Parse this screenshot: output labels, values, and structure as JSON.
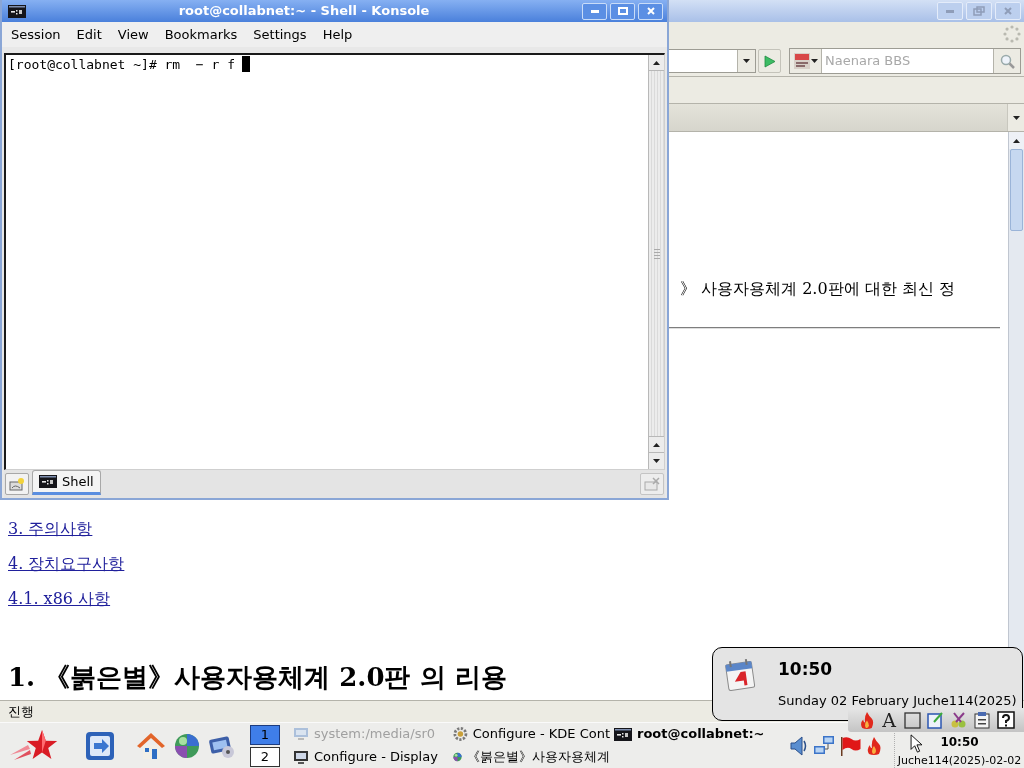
{
  "konsole": {
    "title": "root@collabnet:~ - Shell - Konsole",
    "menu": [
      "Session",
      "Edit",
      "View",
      "Bookmarks",
      "Settings",
      "Help"
    ],
    "terminal": {
      "command_line": "[root@collabnet ~]# rm  − r f"
    },
    "tabs": [
      {
        "label": "Shell",
        "selected": true
      }
    ]
  },
  "browser": {
    "search_field": {
      "placeholder": "Naenara BBS"
    },
    "content": {
      "paragraph": "》 사용자용체계 2.0판에 대한 최신 정",
      "links": [
        "3. 주의사항",
        "4. 장치요구사항",
        "4.1. x86 사항"
      ],
      "heading": "1. 《붉은별》사용자용체계 2.0판 의 리용"
    },
    "status_bar": "진행"
  },
  "taskbar": {
    "desktops": [
      {
        "label": "1",
        "selected": true
      },
      {
        "label": "2",
        "selected": false
      }
    ],
    "tasks": [
      {
        "label": "system:/media/sr0",
        "active": false,
        "minimized": true
      },
      {
        "label": "Configure - KDE Cont",
        "active": false,
        "minimized": false
      },
      {
        "label": "root@collabnet:~",
        "active": true,
        "minimized": false
      },
      {
        "label": "Configure - Display",
        "active": false,
        "minimized": false
      },
      {
        "label": "《붉은별》사용자용체계",
        "active": false,
        "minimized": false
      }
    ],
    "clock": {
      "time": "10:50",
      "date": "Juche114(2025)-02-02"
    }
  },
  "tray_toolbar": {
    "letter_button": "A"
  },
  "clock_popup": {
    "time": "10:50",
    "date": "Sunday 02 February Juche114(2025)"
  }
}
